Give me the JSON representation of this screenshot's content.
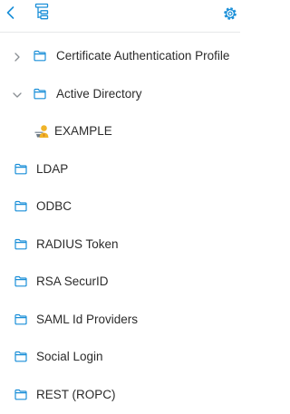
{
  "toolbar": {
    "back_icon": "chevron-left-icon",
    "tree_icon": "tree-view-icon",
    "settings_icon": "gear-icon",
    "accent_color": "#1a8fd8"
  },
  "tree": {
    "items": [
      {
        "label": "Certificate Authentication Profile",
        "icon": "folder-icon",
        "expander": "chevron-right-icon",
        "level": 1
      },
      {
        "label": "Active Directory",
        "icon": "folder-icon",
        "expander": "chevron-down-icon",
        "level": 1
      },
      {
        "label": "EXAMPLE",
        "icon": "ad-domain-icon",
        "level": 2
      },
      {
        "label": "LDAP",
        "icon": "folder-icon",
        "level": 0
      },
      {
        "label": "ODBC",
        "icon": "folder-icon",
        "level": 0
      },
      {
        "label": "RADIUS Token",
        "icon": "folder-icon",
        "level": 0
      },
      {
        "label": "RSA SecurID",
        "icon": "folder-icon",
        "level": 0
      },
      {
        "label": "SAML Id Providers",
        "icon": "folder-icon",
        "level": 0
      },
      {
        "label": "Social Login",
        "icon": "folder-icon",
        "level": 0
      },
      {
        "label": "REST (ROPC)",
        "icon": "folder-icon",
        "level": 0
      }
    ]
  }
}
